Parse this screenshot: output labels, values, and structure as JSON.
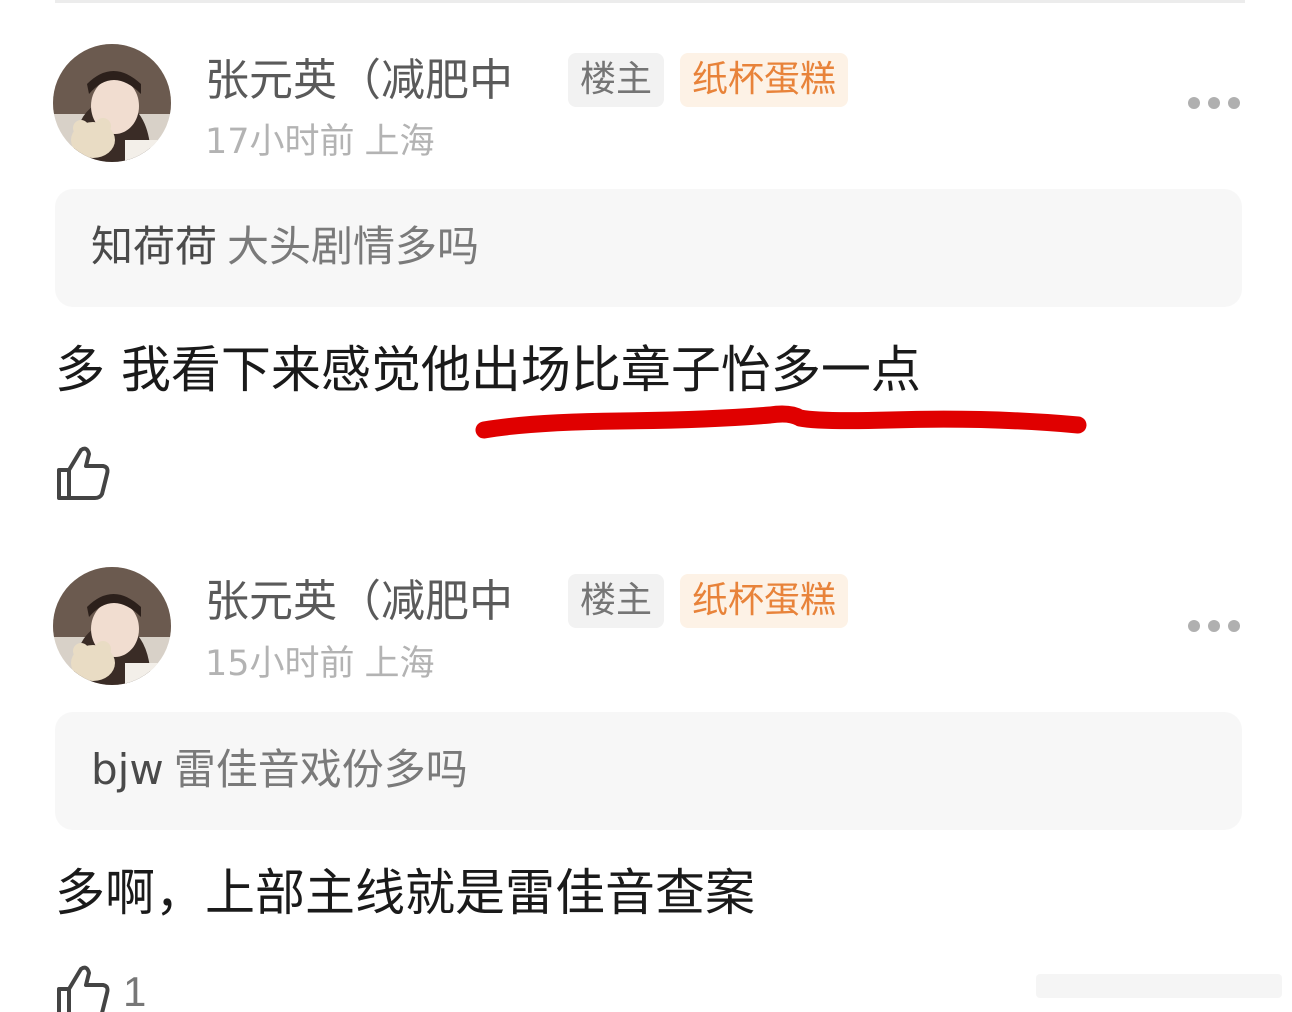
{
  "replies": [
    {
      "username": "张元英（减肥中",
      "badge_op": "楼主",
      "badge_group": "纸杯蛋糕",
      "time": "17小时前",
      "location": "上海",
      "quote_user": "知荷荷",
      "quote_text": "大头剧情多吗",
      "body": "多 我看下来感觉他出场比章子怡多一点",
      "likes": ""
    },
    {
      "username": "张元英（减肥中",
      "badge_op": "楼主",
      "badge_group": "纸杯蛋糕",
      "time": "15小时前",
      "location": "上海",
      "quote_user": "bjw",
      "quote_text": "雷佳音戏份多吗",
      "body": "多啊，上部主线就是雷佳音查案",
      "likes": "1"
    }
  ],
  "icons": {
    "more": "more-dots-icon",
    "like": "thumbs-up-icon"
  },
  "colors": {
    "badge_group_text": "#e8833a",
    "badge_group_bg": "#fdf2e6",
    "underline": "#e00000"
  }
}
